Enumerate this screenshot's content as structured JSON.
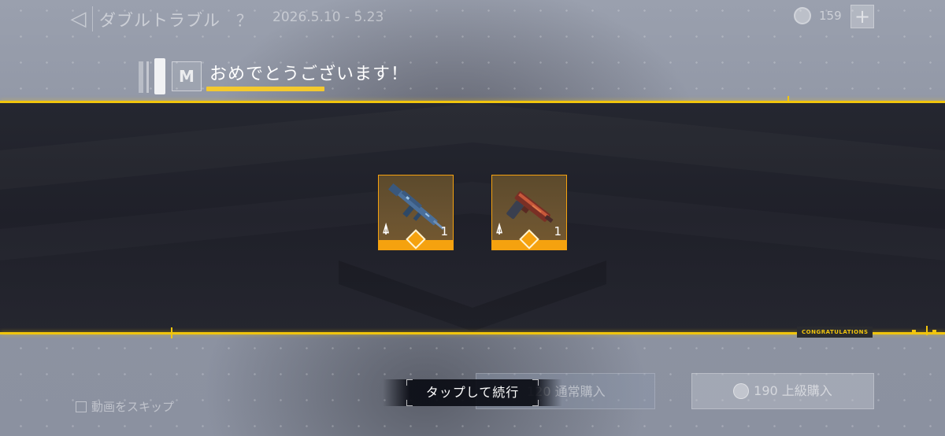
{
  "header": {
    "back_icon": "back-arrow-icon",
    "event_title": "ダブルトラブル",
    "help_label": "？",
    "event_date": "2026.5.10 - 5.23",
    "currency_icon": "cod-points-icon",
    "currency_amount": "159",
    "add_label": "+"
  },
  "congrats": {
    "title": "おめでとうございます！",
    "logo_text": "M",
    "banner_label": "CONGRATULATIONS"
  },
  "rewards": [
    {
      "type": "blueprint",
      "icon": "compass-icon",
      "weapon_icon": "assault-rifle-icon",
      "quantity": "1",
      "rarity_color": "#f5a20f"
    },
    {
      "type": "blueprint",
      "icon": "compass-icon",
      "weapon_icon": "pistol-icon",
      "quantity": "1",
      "rarity_color": "#f5a20f"
    }
  ],
  "footer": {
    "skip_label": "動画をスキップ",
    "buy_normal_label": "120 通常購入",
    "buy_premium_label": "190 上級購入",
    "tap_continue": "タップして続行"
  },
  "colors": {
    "accent_yellow": "#f1c50d",
    "rarity_orange": "#f5a20f",
    "panel_dark": "#22232c"
  }
}
